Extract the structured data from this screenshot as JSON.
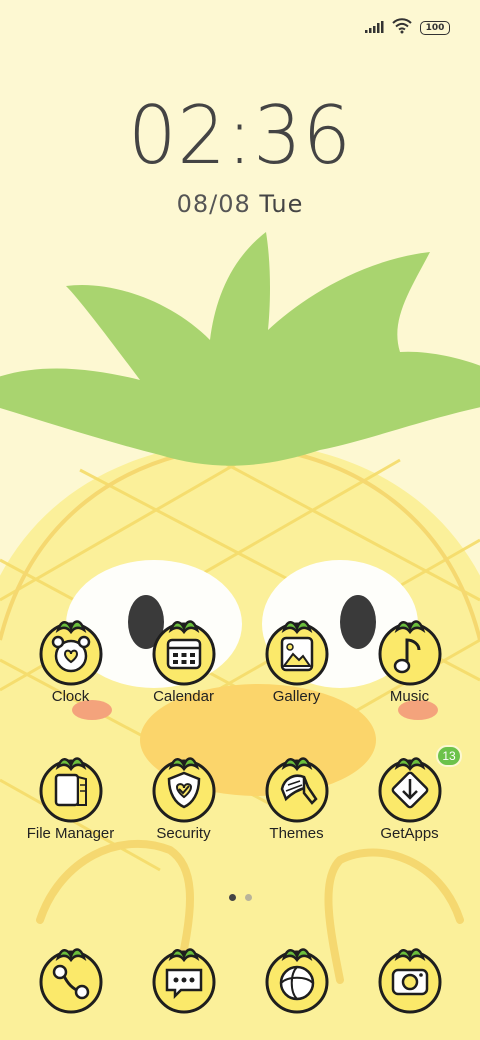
{
  "status_bar": {
    "battery": "100",
    "signal_icon": "signal-icon",
    "wifi_icon": "wifi-icon"
  },
  "lock_widget": {
    "time": "02:36",
    "date": "08/08",
    "weekday": "Tue"
  },
  "apps_row1": [
    {
      "label": "Clock",
      "icon": "alarm-clock-icon"
    },
    {
      "label": "Calendar",
      "icon": "calendar-icon"
    },
    {
      "label": "Gallery",
      "icon": "picture-icon"
    },
    {
      "label": "Music",
      "icon": "music-note-icon"
    }
  ],
  "apps_row2": [
    {
      "label": "File Manager",
      "icon": "folder-icon"
    },
    {
      "label": "Security",
      "icon": "shield-icon"
    },
    {
      "label": "Themes",
      "icon": "paintbrush-icon"
    },
    {
      "label": "GetApps",
      "icon": "download-icon",
      "badge": "13"
    }
  ],
  "dock": [
    {
      "icon": "phone-icon"
    },
    {
      "icon": "messages-icon"
    },
    {
      "icon": "browser-icon"
    },
    {
      "icon": "camera-icon"
    }
  ],
  "pages": {
    "count": 2,
    "active": 1
  },
  "colors": {
    "background": "#fdf8d2",
    "pineapple_leaf": "#a9d46f",
    "pineapple_body": "#fbf09a",
    "accent_green": "#6cc24a"
  }
}
